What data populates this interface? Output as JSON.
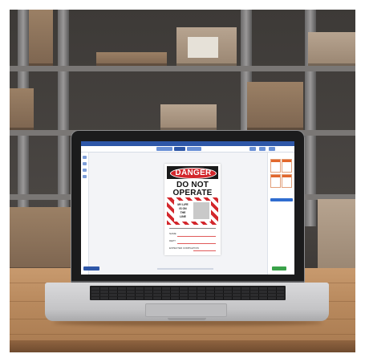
{
  "scene": {
    "description": "",
    "colors": {
      "danger_red": "#d3272c",
      "app_blue": "#2e57a8",
      "action_green": "#3aa24a"
    }
  },
  "document": {
    "header": "DANGER",
    "headline_1": "DO NOT",
    "headline_2": "OPERATE",
    "small_lines": [
      "MY LIFE",
      "IS ON",
      "THE",
      "LINE"
    ],
    "fields": [
      "NAME",
      "DEPT",
      "EXPECTED COMPLETION"
    ]
  },
  "icons": [
    "app-logo-icon",
    "left-tool-icon",
    "panel-thumbnail-icon"
  ]
}
